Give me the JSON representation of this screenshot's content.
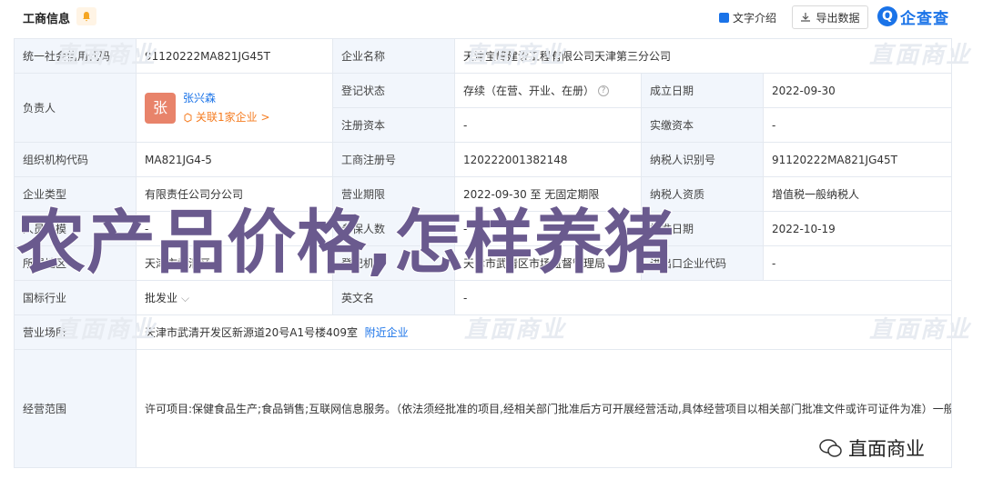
{
  "header": {
    "title": "工商信息",
    "intro_label": "文字介绍",
    "export_label": "导出数据",
    "logo_text": "企查查",
    "logo_mark": "Q"
  },
  "rows": {
    "credit_code": {
      "label": "统一社会信用代码",
      "value": "91120222MA821JG45T"
    },
    "company_name": {
      "label": "企业名称",
      "value": "天津宝峰建设工程有限公司天津第三分公司"
    },
    "legal_person": {
      "label": "负责人",
      "avatar": "张",
      "name": "张兴森",
      "relation": "关联1家企业 >"
    },
    "reg_status": {
      "label": "登记状态",
      "value": "存续（在营、开业、在册）"
    },
    "found_date": {
      "label": "成立日期",
      "value": "2022-09-30"
    },
    "reg_capital": {
      "label": "注册资本",
      "value": "-"
    },
    "paid_capital": {
      "label": "实缴资本",
      "value": "-"
    },
    "org_code": {
      "label": "组织机构代码",
      "value": "MA821JG4-5"
    },
    "reg_no": {
      "label": "工商注册号",
      "value": "120222001382148"
    },
    "taxpayer_id": {
      "label": "纳税人识别号",
      "value": "91120222MA821JG45T"
    },
    "company_type": {
      "label": "企业类型",
      "value": "有限责任公司分公司"
    },
    "biz_term": {
      "label": "营业期限",
      "value": "2022-09-30 至 无固定期限"
    },
    "taxpayer_type": {
      "label": "纳税人资质",
      "value": "增值税一般纳税人"
    },
    "staff": {
      "label": "人员规模",
      "value": "-"
    },
    "insured": {
      "label": "参保人数",
      "value": "-"
    },
    "approve_date": {
      "label": "核准日期",
      "value": "2022-10-19"
    },
    "region": {
      "label": "所属地区",
      "value": "天津市武清区"
    },
    "authority": {
      "label": "登记机关",
      "value": "天津市武清区市场监督管理局"
    },
    "ie_code": {
      "label": "进出口企业代码",
      "value": "-"
    },
    "industry": {
      "label": "国标行业",
      "value": "批发业"
    },
    "english_name": {
      "label": "英文名",
      "value": "-"
    },
    "address": {
      "label": "营业场所",
      "value": "天津市武清开发区新源道20号A1号楼409室",
      "link": "附近企业"
    },
    "scope": {
      "label": "经营范围",
      "value": "许可项目:保健食品生产;食品销售;互联网信息服务。（依法须经批准的项目,经相关部门批准后方可开展经营活动,具体经营项目以相关部门批准文件或许可证件为准）一般项目:货物进出口;化妆品零售;化妆品批发;个人卫生用品销售;日用百货销售;日用杂品销售;卫生用品和一次性使用医疗用品销售;服装服饰批发;服装服饰零售;日用家电零售;家用电器销售;五金产品批发;五金产品零售;计算机软硬件及辅助设备批发;计算机软硬件及辅助设备零售;互联网数据服务;信息技术咨询服务;信息系统运行维护服务;通讯设备销售;体育用品及器材零售;体育用品及器材批发;日用电器修理;信息咨询服务（不含许可类信息咨询服务）;技术服务、技术开发、技术咨询、技术交流、技术转让、技术推广;市场调查（不含涉外调查）;社会调查（不含涉外调查）;市场营销策划;针纺织品销售;建筑材料销售;建筑防水卷材产品销售;建筑装饰材料销售;会议及展览服务;针纺织品及原料销售;第二类医疗器械销售。（除依法须经批准的项目外,凭营业执照依法自主开展经营活动）"
    }
  },
  "watermark_text": "直面商业",
  "overlay_text": "农产品价格,怎样养猪",
  "brand_text": "直面商业"
}
